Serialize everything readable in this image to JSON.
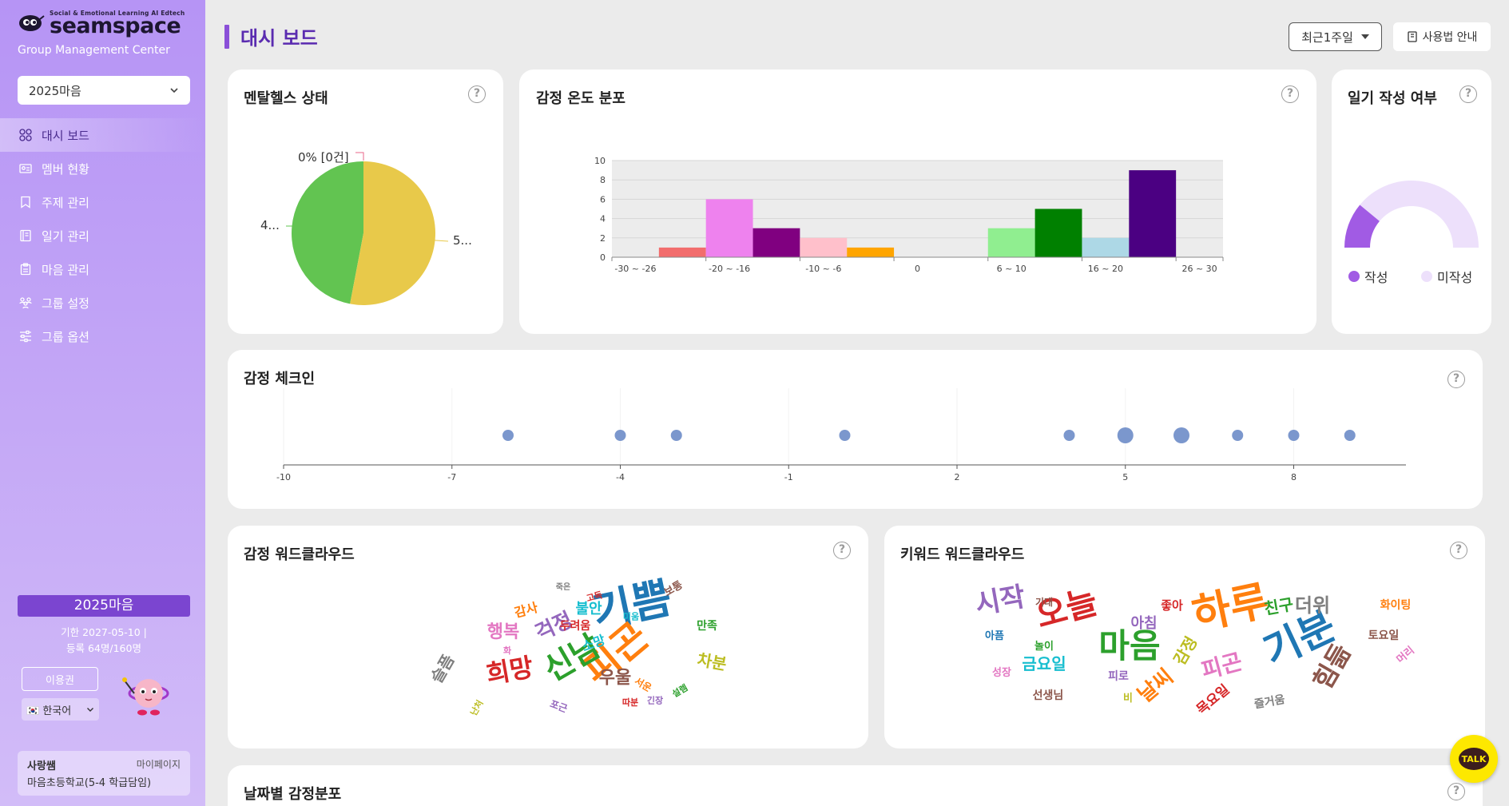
{
  "sidebar": {
    "brand_tag": "Social & Emotional Learning AI Edtech",
    "brand_name": "seamspace",
    "brand_sub": "Group Management Center",
    "org_select": "2025마음",
    "nav": [
      {
        "label": "대시 보드",
        "icon": "dashboard-icon"
      },
      {
        "label": "멤버 현황",
        "icon": "member-card-icon"
      },
      {
        "label": "주제 관리",
        "icon": "bookmark-icon"
      },
      {
        "label": "일기 관리",
        "icon": "diary-icon"
      },
      {
        "label": "마음 관리",
        "icon": "clipboard-icon"
      },
      {
        "label": "그룹 설정",
        "icon": "group-icon"
      },
      {
        "label": "그룹 옵션",
        "icon": "sliders-icon"
      }
    ],
    "group_name": "2025마음",
    "expire": "기한 2027-05-10  |",
    "registered": "등록 64명/160명",
    "ticket_button": "이용권",
    "language": "🇰🇷 한국어",
    "user_name": "사랑쌤",
    "mypage": "마이페이지",
    "school": "마음초등학교(5-4 학급담임)"
  },
  "header": {
    "title": "대시 보드",
    "period": "최근1주일",
    "guide": "사용법 안내"
  },
  "cards": {
    "mental_health": {
      "title": "멘탈헬스 상태",
      "label_top": "0% [0건]",
      "label_left": "4...",
      "label_right": "5..."
    },
    "emotion_temp": {
      "title": "감정 온도 분포"
    },
    "diary": {
      "title": "일기 작성 여부",
      "legend_done": "작성",
      "legend_not": "미작성"
    },
    "checkin": {
      "title": "감정 체크인"
    },
    "emotion_cloud": {
      "title": "감정 워드클라우드"
    },
    "keyword_cloud": {
      "title": "키워드 워드클라우드"
    },
    "daily": {
      "title": "날짜별 감정분포"
    }
  },
  "help_mark": "?",
  "talk": "TALK",
  "colors": {
    "accent": "#8a4fd8",
    "title": "#5a2bb0",
    "done": "#a15be4",
    "not_done": "#ede0fb"
  },
  "chart_data": [
    {
      "type": "pie",
      "categories": [
        "0% [0건]",
        "4...",
        "5..."
      ],
      "values": [
        0,
        47,
        53
      ],
      "colors": [
        "#e8658a",
        "#62c451",
        "#e8c94a"
      ]
    },
    {
      "type": "bar",
      "x_tick_labels": [
        "-30 ~ -26",
        "-20 ~ -16",
        "-10 ~ -6",
        "0",
        "6 ~ 10",
        "16 ~ 20",
        "26 ~ 30"
      ],
      "bins": [
        "-30 ~ -26",
        "-25 ~ -21",
        "-20 ~ -16",
        "-15 ~ -11",
        "-10 ~ -6",
        "-5 ~ -1",
        "0",
        "1 ~ 5",
        "6 ~ 10",
        "11 ~ 15",
        "16 ~ 20",
        "21 ~ 25",
        "26 ~ 30"
      ],
      "values": [
        0,
        1,
        6,
        3,
        2,
        1,
        0,
        0,
        3,
        5,
        2,
        9,
        0
      ],
      "colors": [
        "#f26d6d",
        "#f26d6d",
        "#ee82ee",
        "#800080",
        "#ffc0cb",
        "#ffa500",
        "#cccccc",
        "#cccccc",
        "#90ee90",
        "#008000",
        "#add8e6",
        "#4b0082",
        "#4b0082"
      ],
      "yticks": [
        0,
        2,
        4,
        6,
        8,
        10
      ],
      "ylim": [
        0,
        10
      ]
    },
    {
      "type": "pie",
      "categories": [
        "작성",
        "미작성"
      ],
      "values": [
        22,
        78
      ],
      "colors": [
        "#a15be4",
        "#ede0fb"
      ]
    },
    {
      "type": "scatter",
      "xlim": [
        -10,
        10
      ],
      "xticks": [
        -10,
        -7,
        -4,
        -1,
        2,
        5,
        8
      ],
      "points": [
        {
          "x": -6,
          "size": 1
        },
        {
          "x": -4,
          "size": 1
        },
        {
          "x": -3,
          "size": 1
        },
        {
          "x": 0,
          "size": 1
        },
        {
          "x": 4,
          "size": 1
        },
        {
          "x": 5,
          "size": 2
        },
        {
          "x": 6,
          "size": 2
        },
        {
          "x": 7,
          "size": 1
        },
        {
          "x": 8,
          "size": 1
        },
        {
          "x": 9,
          "size": 1
        }
      ]
    }
  ],
  "emotion_words": [
    {
      "t": "기쁨",
      "c": "#1f77b4",
      "s": 54,
      "r": -12
    },
    {
      "t": "피곤",
      "c": "#ff7f0e",
      "s": 48,
      "r": -40
    },
    {
      "t": "신남",
      "c": "#2ca02c",
      "s": 40,
      "r": -30
    },
    {
      "t": "희망",
      "c": "#d62728",
      "s": 32,
      "r": -10
    },
    {
      "t": "걱정",
      "c": "#9467bd",
      "s": 26,
      "r": -25
    },
    {
      "t": "행복",
      "c": "#e377c2",
      "s": 22,
      "r": 0
    },
    {
      "t": "우울",
      "c": "#8c564b",
      "s": 22,
      "r": 0
    },
    {
      "t": "차분",
      "c": "#bcbd22",
      "s": 20,
      "r": 10
    },
    {
      "t": "불안",
      "c": "#17becf",
      "s": 18,
      "r": 0
    },
    {
      "t": "슬픔",
      "c": "#7f7f7f",
      "s": 20,
      "r": -60
    },
    {
      "t": "소망",
      "c": "#17becf",
      "s": 16,
      "r": -20
    },
    {
      "t": "두려움",
      "c": "#d62728",
      "s": 14,
      "r": 0
    },
    {
      "t": "감사",
      "c": "#ff7f0e",
      "s": 16,
      "r": -15
    },
    {
      "t": "만족",
      "c": "#2ca02c",
      "s": 14,
      "r": 0
    },
    {
      "t": "보통",
      "c": "#8c564b",
      "s": 13,
      "r": -30
    },
    {
      "t": "서운",
      "c": "#ff7f0e",
      "s": 12,
      "r": 30
    },
    {
      "t": "설렘",
      "c": "#2ca02c",
      "s": 11,
      "r": -30
    },
    {
      "t": "긴장",
      "c": "#9467bd",
      "s": 11,
      "r": 0
    },
    {
      "t": "따분",
      "c": "#d62728",
      "s": 11,
      "r": 0
    },
    {
      "t": "포근",
      "c": "#9467bd",
      "s": 12,
      "r": 20
    },
    {
      "t": "난처",
      "c": "#bcbd22",
      "s": 11,
      "r": -60
    },
    {
      "t": "고독",
      "c": "#d62728",
      "s": 11,
      "r": -15
    },
    {
      "t": "죽은",
      "c": "#7f7f7f",
      "s": 10,
      "r": 0
    },
    {
      "t": "화",
      "c": "#e377c2",
      "s": 11,
      "r": 0
    },
    {
      "t": "미움",
      "c": "#17becf",
      "s": 11,
      "r": 0
    }
  ],
  "keyword_words": [
    {
      "t": "하루",
      "c": "#ff7f0e",
      "s": 52,
      "r": -12
    },
    {
      "t": "기분",
      "c": "#1f77b4",
      "s": 50,
      "r": -25
    },
    {
      "t": "마음",
      "c": "#2ca02c",
      "s": 42,
      "r": 0
    },
    {
      "t": "오늘",
      "c": "#d62728",
      "s": 42,
      "r": -15
    },
    {
      "t": "시작",
      "c": "#9467bd",
      "s": 34,
      "r": -10
    },
    {
      "t": "힘듦",
      "c": "#8c564b",
      "s": 32,
      "r": -60
    },
    {
      "t": "피곤",
      "c": "#e377c2",
      "s": 28,
      "r": -15
    },
    {
      "t": "날씨",
      "c": "#ff7f0e",
      "s": 26,
      "r": -40
    },
    {
      "t": "더위",
      "c": "#7f7f7f",
      "s": 24,
      "r": 0
    },
    {
      "t": "금요일",
      "c": "#17becf",
      "s": 20,
      "r": 0
    },
    {
      "t": "감정",
      "c": "#bcbd22",
      "s": 20,
      "r": -60
    },
    {
      "t": "목요일",
      "c": "#d62728",
      "s": 17,
      "r": -40
    },
    {
      "t": "친구",
      "c": "#2ca02c",
      "s": 20,
      "r": -10
    },
    {
      "t": "아침",
      "c": "#9467bd",
      "s": 18,
      "r": 0
    },
    {
      "t": "선생님",
      "c": "#8c564b",
      "s": 14,
      "r": 0
    },
    {
      "t": "즐거움",
      "c": "#7f7f7f",
      "s": 14,
      "r": -10
    },
    {
      "t": "화이팅",
      "c": "#ff7f0e",
      "s": 14,
      "r": 0
    },
    {
      "t": "토요일",
      "c": "#8c564b",
      "s": 14,
      "r": 0
    },
    {
      "t": "좋아",
      "c": "#d62728",
      "s": 15,
      "r": 0
    },
    {
      "t": "피로",
      "c": "#9467bd",
      "s": 14,
      "r": 0
    },
    {
      "t": "놀이",
      "c": "#2ca02c",
      "s": 13,
      "r": 0
    },
    {
      "t": "성장",
      "c": "#e377c2",
      "s": 13,
      "r": 0
    },
    {
      "t": "머리",
      "c": "#e377c2",
      "s": 13,
      "r": -40
    },
    {
      "t": "아픔",
      "c": "#1f77b4",
      "s": 13,
      "r": 0
    },
    {
      "t": "기대",
      "c": "#8c564b",
      "s": 12,
      "r": 0
    },
    {
      "t": "비",
      "c": "#bcbd22",
      "s": 13,
      "r": 0
    }
  ]
}
